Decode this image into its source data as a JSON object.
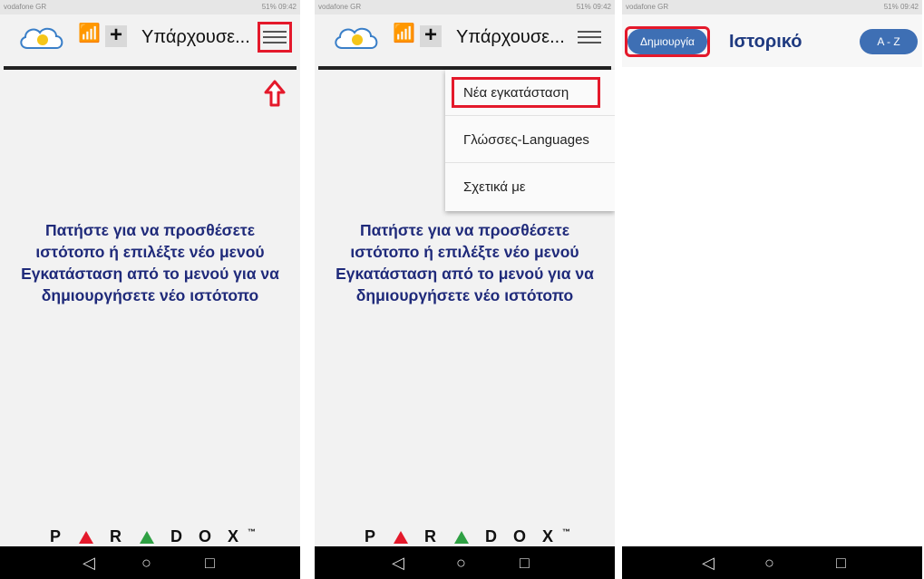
{
  "screens": [
    {
      "status": {
        "carrier": "vodafone GR",
        "right": "51% 09:42"
      },
      "appbar": {
        "title": "Υπάρχουσε...",
        "plus": "+"
      },
      "message": [
        "Πατήστε για να προσθέσετε",
        "ιστότοπο ή επιλέξτε νέο μενού",
        "Εγκατάσταση από το μενού για να",
        "δημιουργήσετε νέο ιστότοπο"
      ],
      "brand": {
        "letters": [
          "P",
          "R",
          "D",
          "O",
          "X"
        ],
        "tm": "™"
      }
    },
    {
      "status": {
        "carrier": "vodafone GR",
        "right": "51% 09:42"
      },
      "appbar": {
        "title": "Υπάρχουσε...",
        "plus": "+"
      },
      "menu": [
        "Νέα εγκατάσταση",
        "Γλώσσες-Languages",
        "Σχετικά με"
      ],
      "message": [
        "Πατήστε για να προσθέσετε",
        "ιστότοπο ή επιλέξτε νέο μενού",
        "Εγκατάσταση από το μενού για να",
        "δημιουργήσετε νέο ιστότοπο"
      ],
      "brand": {
        "letters": [
          "P",
          "R",
          "D",
          "O",
          "X"
        ],
        "tm": "™"
      }
    },
    {
      "status": {
        "carrier": "vodafone GR",
        "right": "51% 09:42"
      },
      "header": {
        "create_label": "Δημιουργία",
        "title": "Ιστορικό",
        "sort_label": "A - Z"
      }
    }
  ],
  "nav": {
    "back": "◁",
    "home": "○",
    "recents": "□"
  },
  "colors": {
    "highlight": "#e4192b",
    "message": "#1f2a7a",
    "pill": "#3e6fb4"
  }
}
